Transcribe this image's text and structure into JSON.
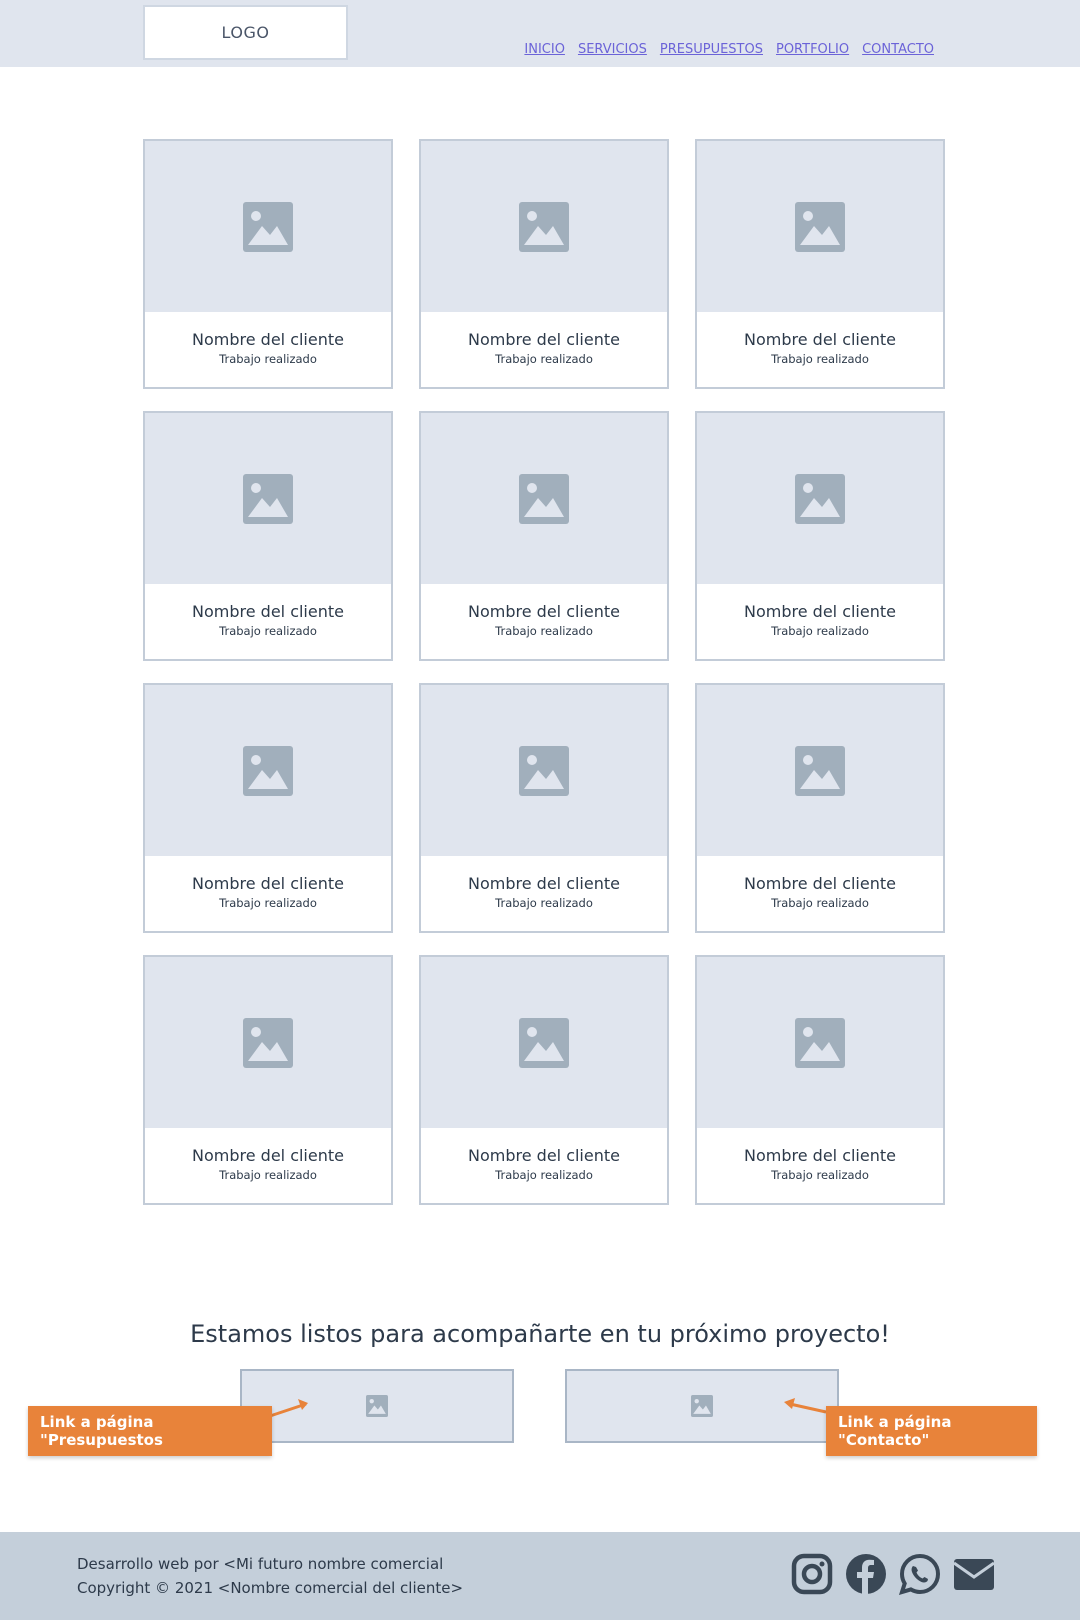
{
  "header": {
    "logo": "LOGO",
    "nav": [
      "INICIO",
      "SERVICIOS",
      "PRESUPUESTOS",
      "PORTFOLIO",
      "CONTACTO"
    ]
  },
  "portfolio": {
    "items": [
      {
        "name": "Nombre del cliente",
        "work": "Trabajo realizado"
      },
      {
        "name": "Nombre del cliente",
        "work": "Trabajo realizado"
      },
      {
        "name": "Nombre del cliente",
        "work": "Trabajo realizado"
      },
      {
        "name": "Nombre del cliente",
        "work": "Trabajo realizado"
      },
      {
        "name": "Nombre del cliente",
        "work": "Trabajo realizado"
      },
      {
        "name": "Nombre del cliente",
        "work": "Trabajo realizado"
      },
      {
        "name": "Nombre del cliente",
        "work": "Trabajo realizado"
      },
      {
        "name": "Nombre del cliente",
        "work": "Trabajo realizado"
      },
      {
        "name": "Nombre del cliente",
        "work": "Trabajo realizado"
      },
      {
        "name": "Nombre del cliente",
        "work": "Trabajo realizado"
      },
      {
        "name": "Nombre del cliente",
        "work": "Trabajo realizado"
      },
      {
        "name": "Nombre del cliente",
        "work": "Trabajo realizado"
      }
    ]
  },
  "cta": {
    "title": "Estamos listos para acompañarte en tu próximo proyecto!",
    "note_left": "Link a página \"Presupuestos",
    "note_right": "Link a página \"Contacto\""
  },
  "footer": {
    "line1": "Desarrollo web por <Mi futuro nombre comercial",
    "line2": "Copyright © 2021 <Nombre comercial del cliente>",
    "social_icons": [
      "instagram-icon",
      "facebook-icon",
      "whatsapp-icon",
      "email-icon"
    ]
  },
  "colors": {
    "header_bg": "#e0e5ee",
    "placeholder_bg": "#e0e5ee",
    "placeholder_icon": "#a1afbc",
    "nav_link": "#6b63d8",
    "note_bg": "#e8833a",
    "footer_bg": "#c4cfda",
    "text": "#2d3a4a"
  }
}
